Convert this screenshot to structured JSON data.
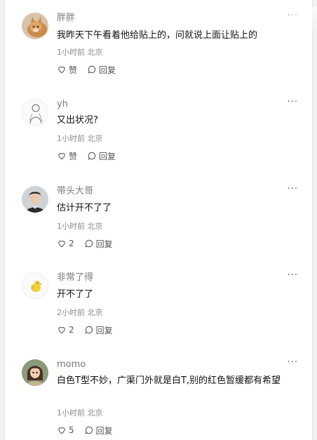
{
  "comments": [
    {
      "username": "胖胖",
      "text": "我昨天下午看着他给贴上的，问就说上面让贴上的",
      "time": "1小时前",
      "location": "北京",
      "like_label": "赞",
      "reply_label": "回复",
      "more": "···",
      "avatar_icon": "cat-photo-avatar"
    },
    {
      "username": "yh",
      "text": "又出状况?",
      "time": "1小时前",
      "location": "北京",
      "like_label": "赞",
      "reply_label": "回复",
      "more": "···",
      "avatar_icon": "sketch-figure-avatar"
    },
    {
      "username": "带头大哥",
      "text": "估计开不了了",
      "time": "1小时前",
      "location": "北京",
      "like_label": "2",
      "reply_label": "回复",
      "more": "···",
      "avatar_icon": "man-portrait-avatar"
    },
    {
      "username": "非常了得",
      "text": "开不了了",
      "time": "2小时前",
      "location": "北京",
      "like_label": "2",
      "reply_label": "回复",
      "more": "···",
      "avatar_icon": "yellow-bird-avatar"
    },
    {
      "username": "momo",
      "text": "白色T型不妙，广渠门外就是白T,别的红色暂缓都有希望",
      "time": "1小时前",
      "location": "北京",
      "like_label": "5",
      "reply_label": "回复",
      "more": "···",
      "avatar_icon": "girl-cartoon-avatar"
    }
  ]
}
